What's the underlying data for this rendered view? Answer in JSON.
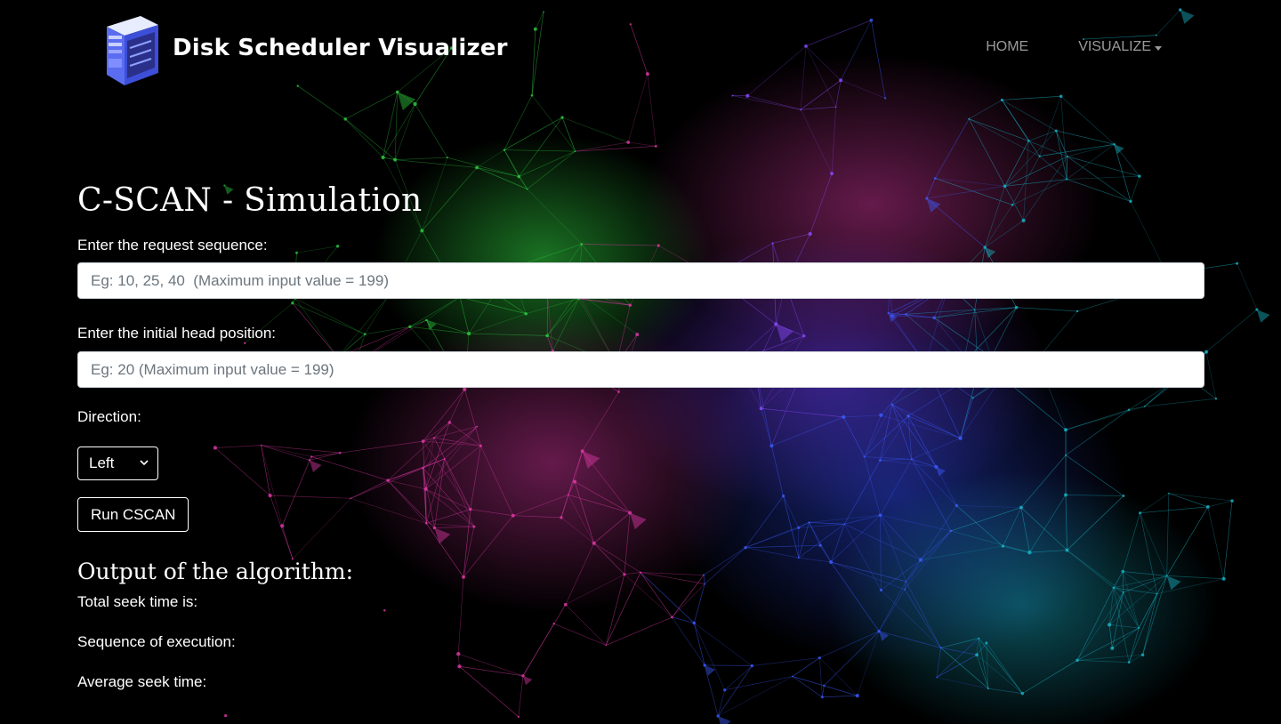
{
  "brand": {
    "title": "Disk Scheduler Visualizer"
  },
  "nav": {
    "home": "HOME",
    "visualize": "VISUALIZE"
  },
  "page": {
    "title": "C-SCAN - Simulation"
  },
  "form": {
    "request_label": "Enter the request sequence:",
    "request_placeholder": "Eg: 10, 25, 40  (Maximum input value = 199)",
    "request_value": "",
    "head_label": "Enter the initial head position:",
    "head_placeholder": "Eg: 20 (Maximum input value = 199)",
    "head_value": "",
    "direction_label": "Direction:",
    "direction_selected": "Left",
    "run_label": "Run CSCAN"
  },
  "output": {
    "title": "Output of the algorithm:",
    "total_seek": "Total seek time is:",
    "sequence": "Sequence of execution:",
    "average_seek": "Average seek time:"
  },
  "colors": {
    "background": "#000000",
    "network_green": "#2ecc40",
    "network_magenta": "#e03aa8",
    "network_purple": "#8a4bff",
    "network_blue": "#3b5bff",
    "network_cyan": "#19b5c8"
  }
}
